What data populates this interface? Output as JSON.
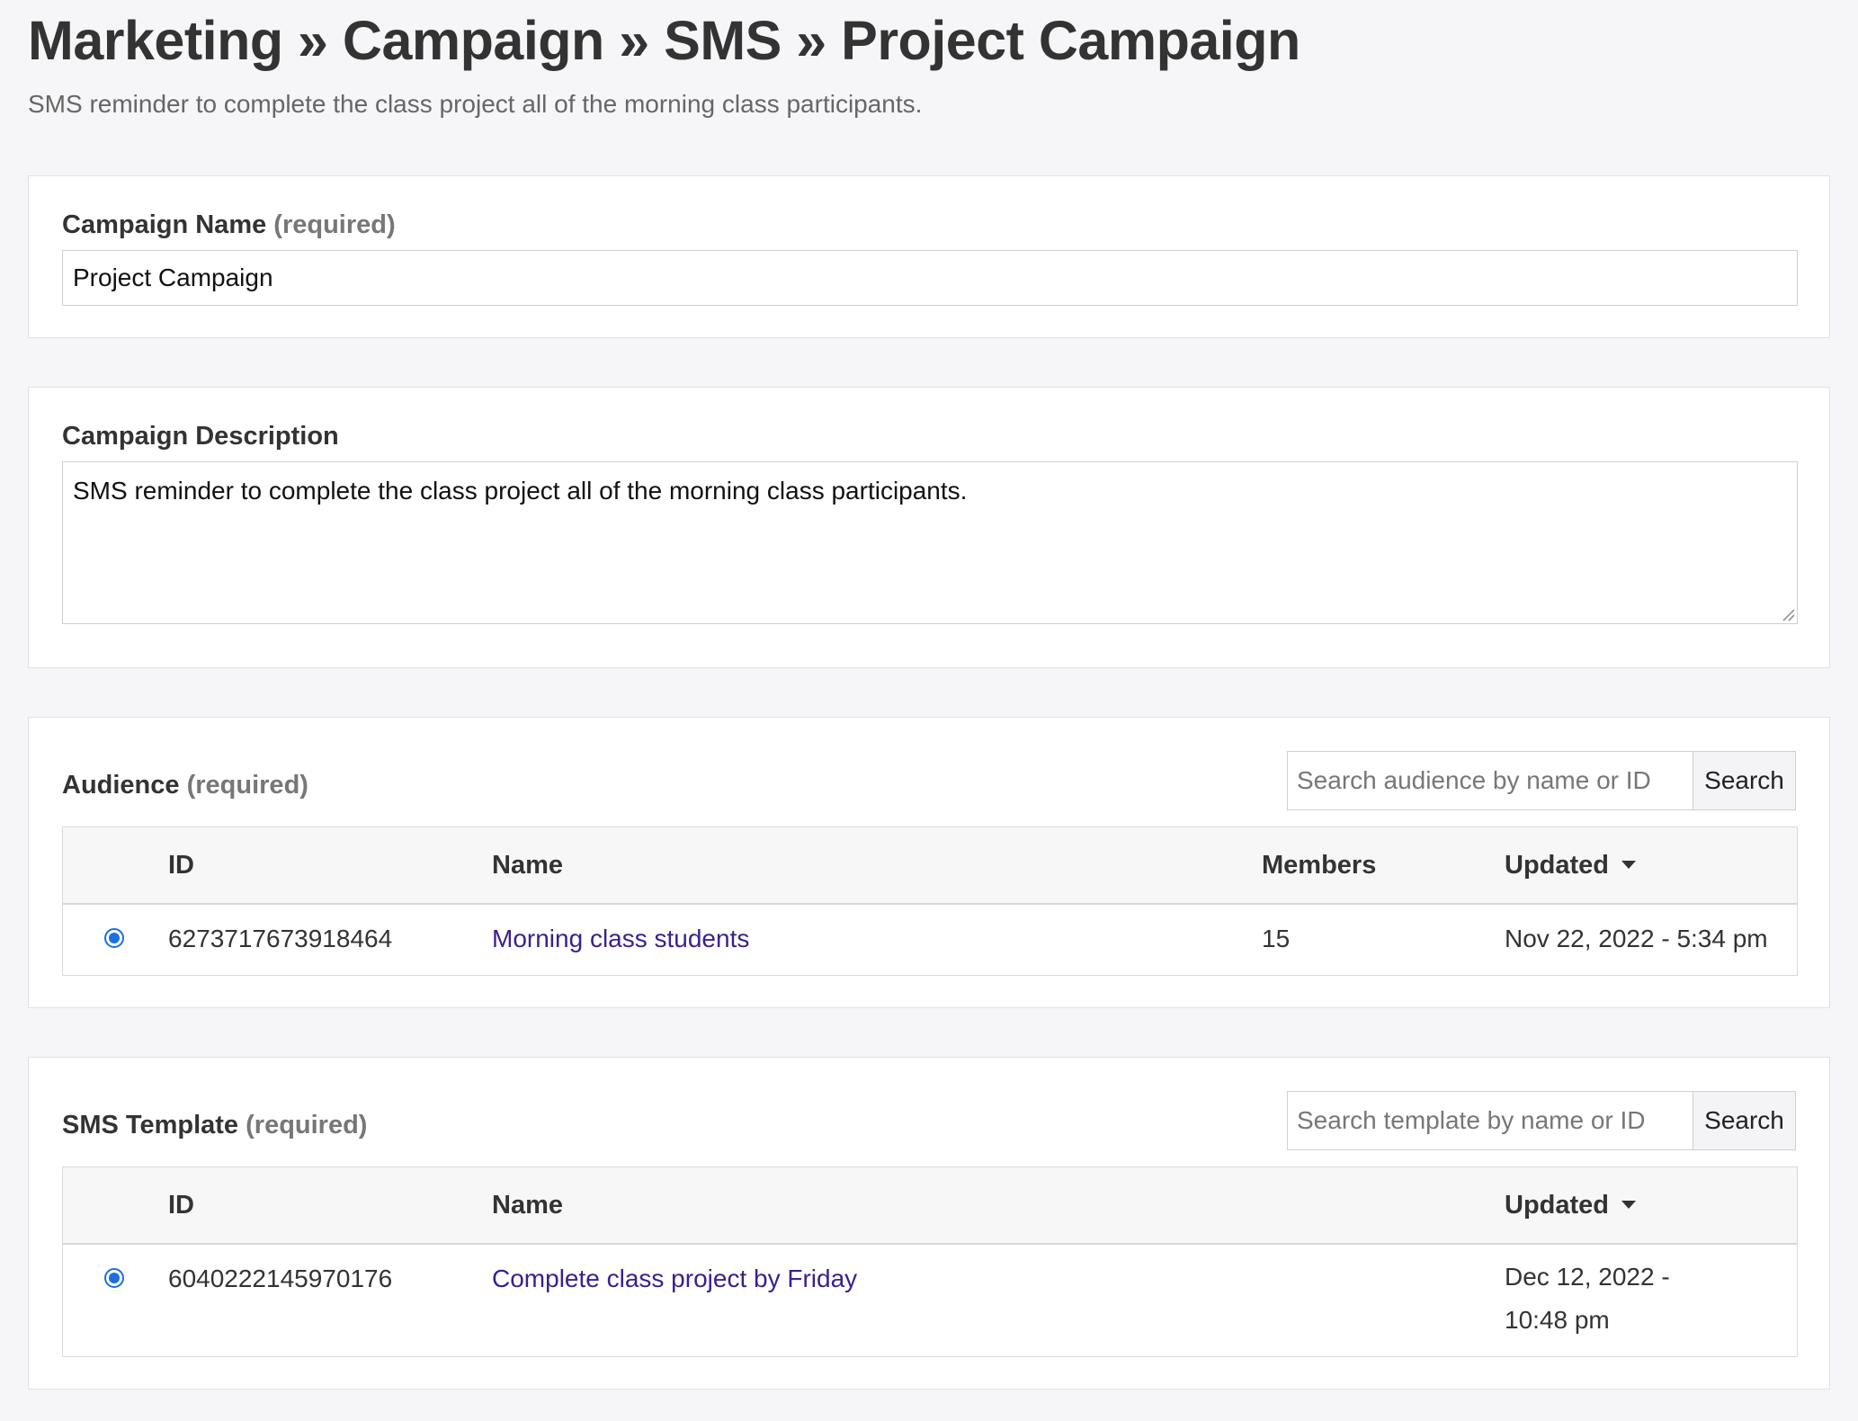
{
  "page": {
    "breadcrumb": "Marketing » Campaign » SMS » Project Campaign",
    "subtitle": "SMS reminder to complete the class project all of the morning class participants."
  },
  "campaign_name": {
    "label": "Campaign Name",
    "required_text": "(required)",
    "value": "Project Campaign"
  },
  "campaign_description": {
    "label": "Campaign Description",
    "value": "SMS reminder to complete the class project all of the morning class participants."
  },
  "audience": {
    "label": "Audience",
    "required_text": "(required)",
    "search_placeholder": "Search audience by name or ID",
    "search_button": "Search",
    "columns": {
      "id": "ID",
      "name": "Name",
      "members": "Members",
      "updated": "Updated"
    },
    "rows": [
      {
        "selected": true,
        "id": "6273717673918464",
        "name": "Morning class students",
        "members": "15",
        "updated": "Nov 22, 2022 - 5:34 pm"
      }
    ]
  },
  "sms_template": {
    "label": "SMS Template",
    "required_text": "(required)",
    "search_placeholder": "Search template by name or ID",
    "search_button": "Search",
    "columns": {
      "id": "ID",
      "name": "Name",
      "updated": "Updated"
    },
    "rows": [
      {
        "selected": true,
        "id": "6040222145970176",
        "name": "Complete class project by Friday",
        "updated": "Dec 12, 2022 - 10:48 pm"
      }
    ]
  },
  "colors": {
    "page_bg": "#f6f6f9",
    "link": "#3b1f8c",
    "radio_accent": "#1b6fe0"
  }
}
